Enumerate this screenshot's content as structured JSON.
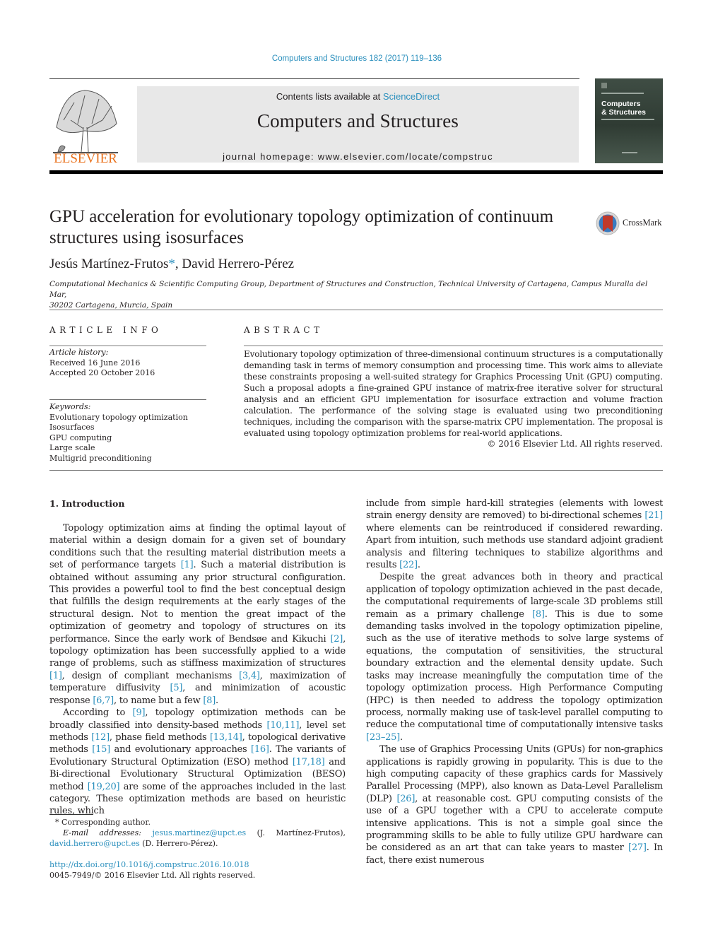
{
  "header": {
    "journal_reference": "Computers and Structures 182 (2017) 119–136",
    "contents_prefix": "Contents lists available at ",
    "contents_link": "ScienceDirect",
    "journal_title": "Computers and Structures",
    "homepage": "journal homepage: www.elsevier.com/locate/compstruc",
    "publisher_logo_text": "ELSEVIER",
    "cover_title_line1": "Computers",
    "cover_title_line2": "& Structures",
    "crossmark_label": "CrossMark"
  },
  "article": {
    "title_line1": "GPU acceleration for evolutionary topology optimization of continuum",
    "title_line2": "structures using isosurfaces",
    "author1": "Jesús Martínez-Frutos",
    "author1_mark": "*",
    "author_sep": ", ",
    "author2": "David Herrero-Pérez",
    "affiliation_line1": "Computational Mechanics & Scientific Computing Group, Department of Structures and Construction, Technical University of Cartagena, Campus Muralla del Mar,",
    "affiliation_line2": "30202 Cartagena, Murcia, Spain"
  },
  "article_info": {
    "caption": "ARTICLE INFO",
    "history_label": "Article history:",
    "received": "Received 16 June 2016",
    "accepted": "Accepted 20 October 2016",
    "keywords_label": "Keywords:",
    "keywords": [
      "Evolutionary topology optimization",
      "Isosurfaces",
      "GPU computing",
      "Large scale",
      "Multigrid preconditioning"
    ]
  },
  "abstract": {
    "caption": "ABSTRACT",
    "text": "Evolutionary topology optimization of three-dimensional continuum structures is a computationally demanding task in terms of memory consumption and processing time. This work aims to alleviate these constraints proposing a well-suited strategy for Graphics Processing Unit (GPU) computing. Such a pro­posal adopts a fine-grained GPU instance of matrix-free iterative solver for structural analysis and an effi­cient GPU implementation for isosurface extraction and volume fraction calculation. The performance of the solving stage is evaluated using two preconditioning techniques, including the comparison with the sparse-matrix CPU implementation. The proposal is evaluated using topology optimization problems for real-world applications.",
    "copyright": "© 2016 Elsevier Ltd. All rights reserved."
  },
  "body": {
    "section_heading": "1. Introduction",
    "left_col": {
      "p1": [
        {
          "t": "Topology optimization aims at finding the optimal layout of material within a design domain for a given set of boundary condi­tions such that the resulting material distribution meets a set of performance targets "
        },
        {
          "r": "[1]"
        },
        {
          "t": ". Such a material distribution is obtained without assuming any prior structural configuration. This provides a powerful tool to find the best conceptual design that fulfills the design requirements at the early stages of the structural design. Not to mention the great impact of the optimization of geometry and topology of structures on its performance. Since the early work of Bendsøe and Kikuchi "
        },
        {
          "r": "[2]"
        },
        {
          "t": ", topology optimization has been suc­cessfully applied to a wide range of problems, such as stiffness maximization of structures "
        },
        {
          "r": "[1]"
        },
        {
          "t": ", design of compliant mechanisms "
        },
        {
          "r": "[3,4]"
        },
        {
          "t": ", maximization of temperature diffusivity "
        },
        {
          "r": "[5]"
        },
        {
          "t": ", and minimiza­tion of acoustic response "
        },
        {
          "r": "[6,7]"
        },
        {
          "t": ", to name but a few "
        },
        {
          "r": "[8]"
        },
        {
          "t": "."
        }
      ],
      "p2": [
        {
          "t": "According to "
        },
        {
          "r": "[9]"
        },
        {
          "t": ", topology optimization methods can be broadly classified into density-based methods "
        },
        {
          "r": "[10,11]"
        },
        {
          "t": ", level set methods "
        },
        {
          "r": "[12]"
        },
        {
          "t": ", phase field methods "
        },
        {
          "r": "[13,14]"
        },
        {
          "t": ", topological derivative methods "
        },
        {
          "r": "[15]"
        },
        {
          "t": " and evolutionary approaches "
        },
        {
          "r": "[16]"
        },
        {
          "t": ". The variants of Evolution­ary Structural Optimization (ESO) method "
        },
        {
          "r": "[17,18]"
        },
        {
          "t": " and Bi-directional Evolutionary Structural Optimization (BESO) method "
        },
        {
          "r": "[19,20]"
        },
        {
          "t": " are some of the approaches included in the last category. These optimization methods are based on heuristic rules, which"
        }
      ]
    },
    "right_col": {
      "p1": [
        {
          "t": "include from simple hard-kill strategies (elements with lowest strain energy density are removed) to bi-directional schemes "
        },
        {
          "r": "[21]"
        },
        {
          "t": " where elements can be reintroduced if considered rewarding. Apart from intuition, such methods use standard adjoint gradient analysis and filtering techniques to stabilize algorithms and results "
        },
        {
          "r": "[22]"
        },
        {
          "t": "."
        }
      ],
      "p2": [
        {
          "t": "Despite the great advances both in theory and practical applica­tion of topology optimization achieved in the past decade, the computational requirements of large-scale 3D problems still remain as a primary challenge "
        },
        {
          "r": "[8]"
        },
        {
          "t": ". This is due to some demanding tasks involved in the topology optimization pipeline, such as the use of iterative methods to solve large systems of equations, the computation of sensitivities, the structural boundary extraction and the elemental density update. Such tasks may increase mean­ingfully the computation time of the topology optimization pro­cess. High Performance Computing (HPC) is then needed to address the topology optimization process, normally making use of task-level parallel computing to reduce the computational time of computationally intensive tasks "
        },
        {
          "r": "[23–25]"
        },
        {
          "t": "."
        }
      ],
      "p3": [
        {
          "t": "The use of Graphics Processing Units (GPUs) for non-graphics applications is rapidly growing in popularity. This is due to the high computing capacity of these graphics cards for Massively Par­allel Processing (MPP), also known as Data-Level Parallelism (DLP) "
        },
        {
          "r": "[26]"
        },
        {
          "t": ", at reasonable cost. GPU computing consists of the use of a GPU together with a CPU to accelerate compute intensive applica­tions. This is not a simple goal since the programming skills to be able to fully utilize GPU hardware can be considered as an art that can take years to master "
        },
        {
          "r": "[27]"
        },
        {
          "t": ". In fact, there exist numerous"
        }
      ]
    }
  },
  "footnotes": {
    "corresponding_mark": "*",
    "corresponding_text": " Corresponding author.",
    "email_label": "E-mail addresses: ",
    "email1": "jesus.martinez@upct.es",
    "email1_owner": " (J. Martínez-Frutos), ",
    "email2": "david.herrero@upct.es",
    "email2_owner": " (D. Herrero-Pérez).",
    "doi": "http://dx.doi.org/10.1016/j.compstruc.2016.10.018",
    "issn_copyright": "0045-7949/© 2016 Elsevier Ltd. All rights reserved."
  },
  "colors": {
    "link": "#2a8fbd",
    "text": "#231f20",
    "elsevier_orange": "#e9711c",
    "banner_bg": "#e8e8e8",
    "crossmark_red": "#c0392b"
  }
}
